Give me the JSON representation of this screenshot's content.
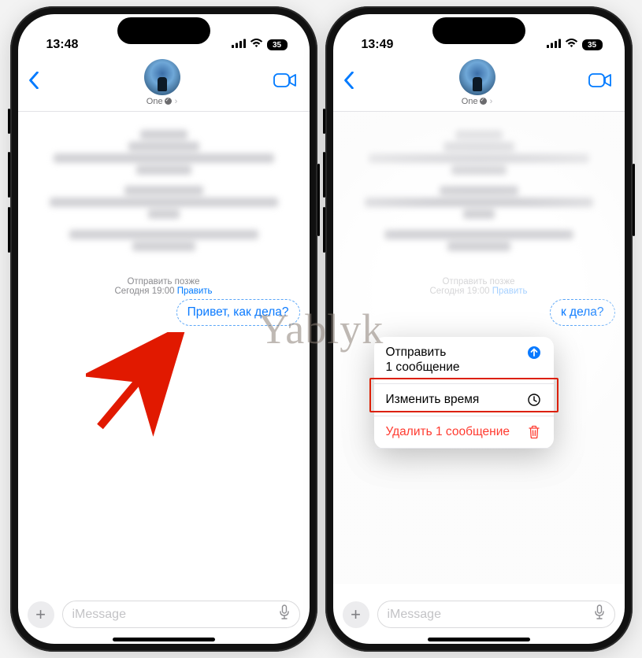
{
  "watermark": "Yablyk",
  "left": {
    "time": "13:48",
    "battery": "35",
    "contact_name": "One",
    "sched_title": "Отправить позже",
    "sched_prefix": "Сегодня 19:00 ",
    "sched_edit": "Править",
    "message": "Привет, как дела?",
    "input_placeholder": "iMessage"
  },
  "right": {
    "time": "13:49",
    "battery": "35",
    "contact_name": "One",
    "sched_title": "Отправить позже",
    "sched_prefix": "Сегодня 19:00 ",
    "sched_edit": "Править",
    "message_tail": "к дела?",
    "menu": {
      "send_line1": "Отправить",
      "send_line2": "1 сообщение",
      "change_time": "Изменить время",
      "delete": "Удалить 1 сообщение"
    },
    "input_placeholder": "iMessage"
  }
}
